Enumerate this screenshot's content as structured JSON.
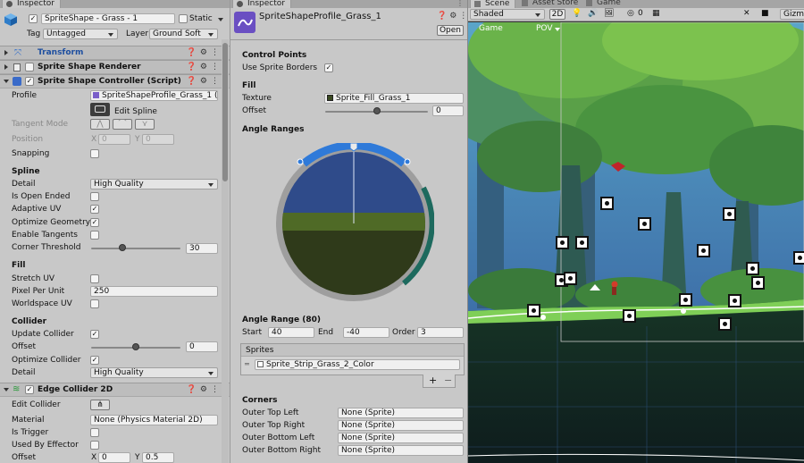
{
  "inspector1": {
    "tab": "Inspector",
    "object_name": "SpriteShape - Grass - 1",
    "static_label": "Static",
    "tag_label": "Tag",
    "tag_value": "Untagged",
    "layer_label": "Layer",
    "layer_value": "Ground Soft",
    "components": {
      "transform": "Transform",
      "renderer": "Sprite Shape Renderer",
      "controller": "Sprite Shape Controller (Script)",
      "edge": "Edge Collider 2D"
    },
    "profile_label": "Profile",
    "profile_value": "SpriteShapeProfile_Grass_1 (S",
    "edit_spline": "Edit Spline",
    "tangent_mode": "Tangent Mode",
    "position": "Position",
    "pos_x": "X",
    "pos_x_val": "0",
    "pos_y": "Y",
    "pos_y_val": "0",
    "snapping": "Snapping",
    "spline_header": "Spline",
    "detail": "Detail",
    "detail_value": "High Quality",
    "is_open_ended": "Is Open Ended",
    "adaptive_uv": "Adaptive UV",
    "optimize_geometry": "Optimize Geometry",
    "enable_tangents": "Enable Tangents",
    "corner_threshold": "Corner Threshold",
    "corner_threshold_value": "30",
    "fill_header": "Fill",
    "stretch_uv": "Stretch UV",
    "pixel_per_unit": "Pixel Per Unit",
    "pixel_per_unit_value": "250",
    "worldspace_uv": "Worldspace UV",
    "collider_header": "Collider",
    "update_collider": "Update Collider",
    "offset": "Offset",
    "offset_value": "0",
    "optimize_collider": "Optimize Collider",
    "detail2": "Detail",
    "detail2_value": "High Quality",
    "edit_collider": "Edit Collider",
    "material": "Material",
    "material_value": "None (Physics Material 2D)",
    "is_trigger": "Is Trigger",
    "used_by_effector": "Used By Effector",
    "offset2": "Offset",
    "offset2_x": "X",
    "offset2_x_val": "0",
    "offset2_y": "Y",
    "offset2_y_val": "0.5"
  },
  "inspector2": {
    "tab": "Inspector",
    "title": "SpriteShapeProfile_Grass_1",
    "open_button": "Open",
    "control_points": "Control Points",
    "use_sprite_borders": "Use Sprite Borders",
    "fill": "Fill",
    "texture": "Texture",
    "texture_value": "Sprite_Fill_Grass_1",
    "offset": "Offset",
    "offset_value": "0",
    "angle_ranges": "Angle Ranges",
    "angle_range_title": "Angle Range (80)",
    "start": "Start",
    "start_value": "40",
    "end": "End",
    "end_value": "-40",
    "order": "Order",
    "order_value": "3",
    "sprites": "Sprites",
    "sprite_item": "Sprite_Strip_Grass_2_Color",
    "plus": "+",
    "minus": "−",
    "corners": "Corners",
    "corner_rows": [
      {
        "label": "Outer Top Left",
        "value": "None (Sprite)"
      },
      {
        "label": "Outer Top Right",
        "value": "None (Sprite)"
      },
      {
        "label": "Outer Bottom Left",
        "value": "None (Sprite)"
      },
      {
        "label": "Outer Bottom Right",
        "value": "None (Sprite)"
      }
    ]
  },
  "scene": {
    "tabs": [
      "Scene",
      "Asset Store",
      "Game"
    ],
    "shaded": "Shaded",
    "mode2d": "2D",
    "gizmos": "Gizmo",
    "layers_count": "0",
    "game_label": "Game",
    "pov_label": "POV"
  }
}
